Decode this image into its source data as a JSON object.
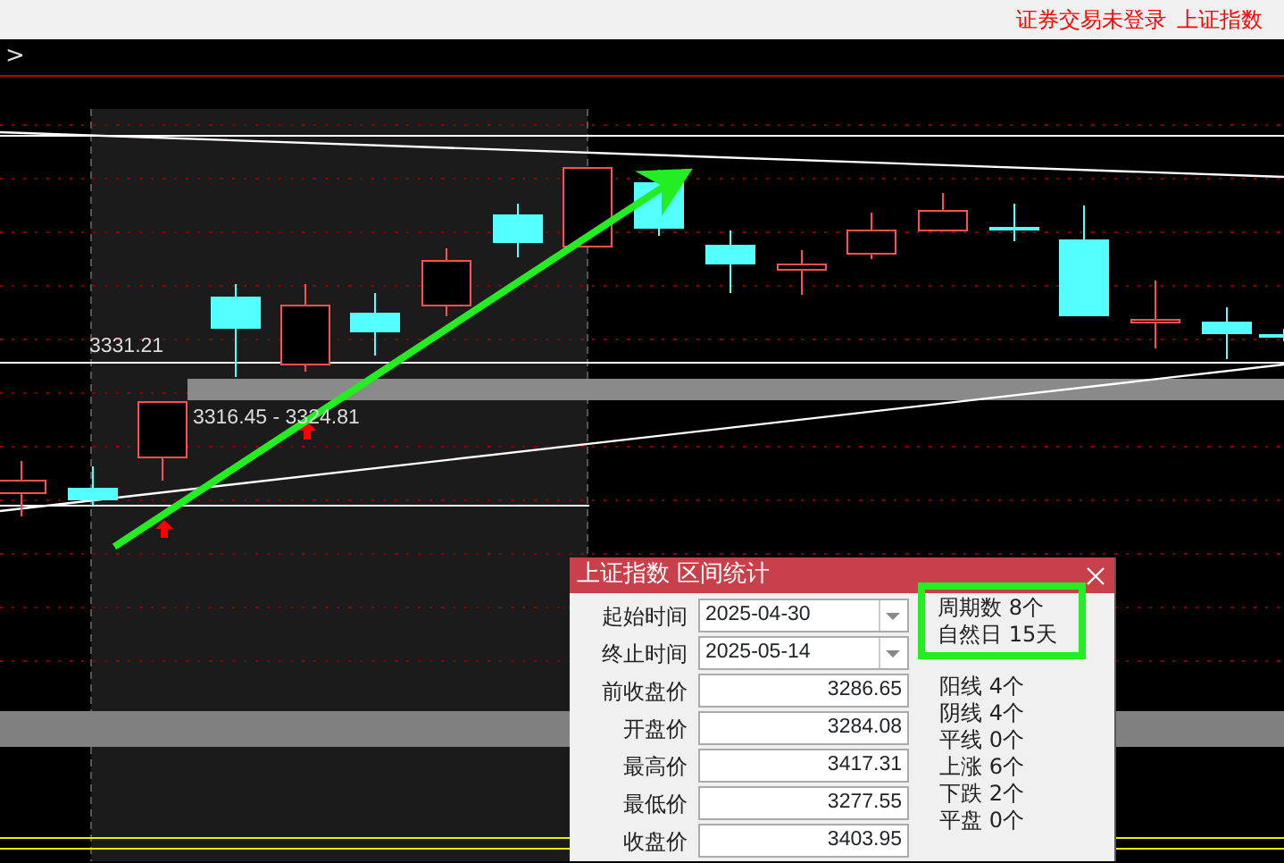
{
  "header": {
    "login_status": "证券交易未登录",
    "index_name": "上证指数"
  },
  "toolbar": {
    "breadcrumb": ">"
  },
  "chart": {
    "labels": [
      "3331.21",
      "3316.45 - 3324.81"
    ]
  },
  "dialog": {
    "title": "上证指数 区间统计",
    "fields": [
      {
        "kind": "dropdown",
        "label": "起始时间",
        "value": "2025-04-30"
      },
      {
        "kind": "dropdown",
        "label": "终止时间",
        "value": "2025-05-14"
      },
      {
        "kind": "number",
        "label": "前收盘价",
        "value": "3286.65"
      },
      {
        "kind": "number",
        "label": "开盘价",
        "value": "3284.08"
      },
      {
        "kind": "number",
        "label": "最高价",
        "value": "3417.31"
      },
      {
        "kind": "number",
        "label": "最低价",
        "value": "3277.55"
      },
      {
        "kind": "number",
        "label": "收盘价",
        "value": "3403.95"
      }
    ],
    "highlighted_stats": [
      "周期数 8个",
      "自然日 15天"
    ],
    "stats": [
      "阳线 4个",
      "阴线 4个",
      "平线 0个",
      "上涨 6个",
      "下跌 2个",
      "平盘 0个"
    ]
  }
}
